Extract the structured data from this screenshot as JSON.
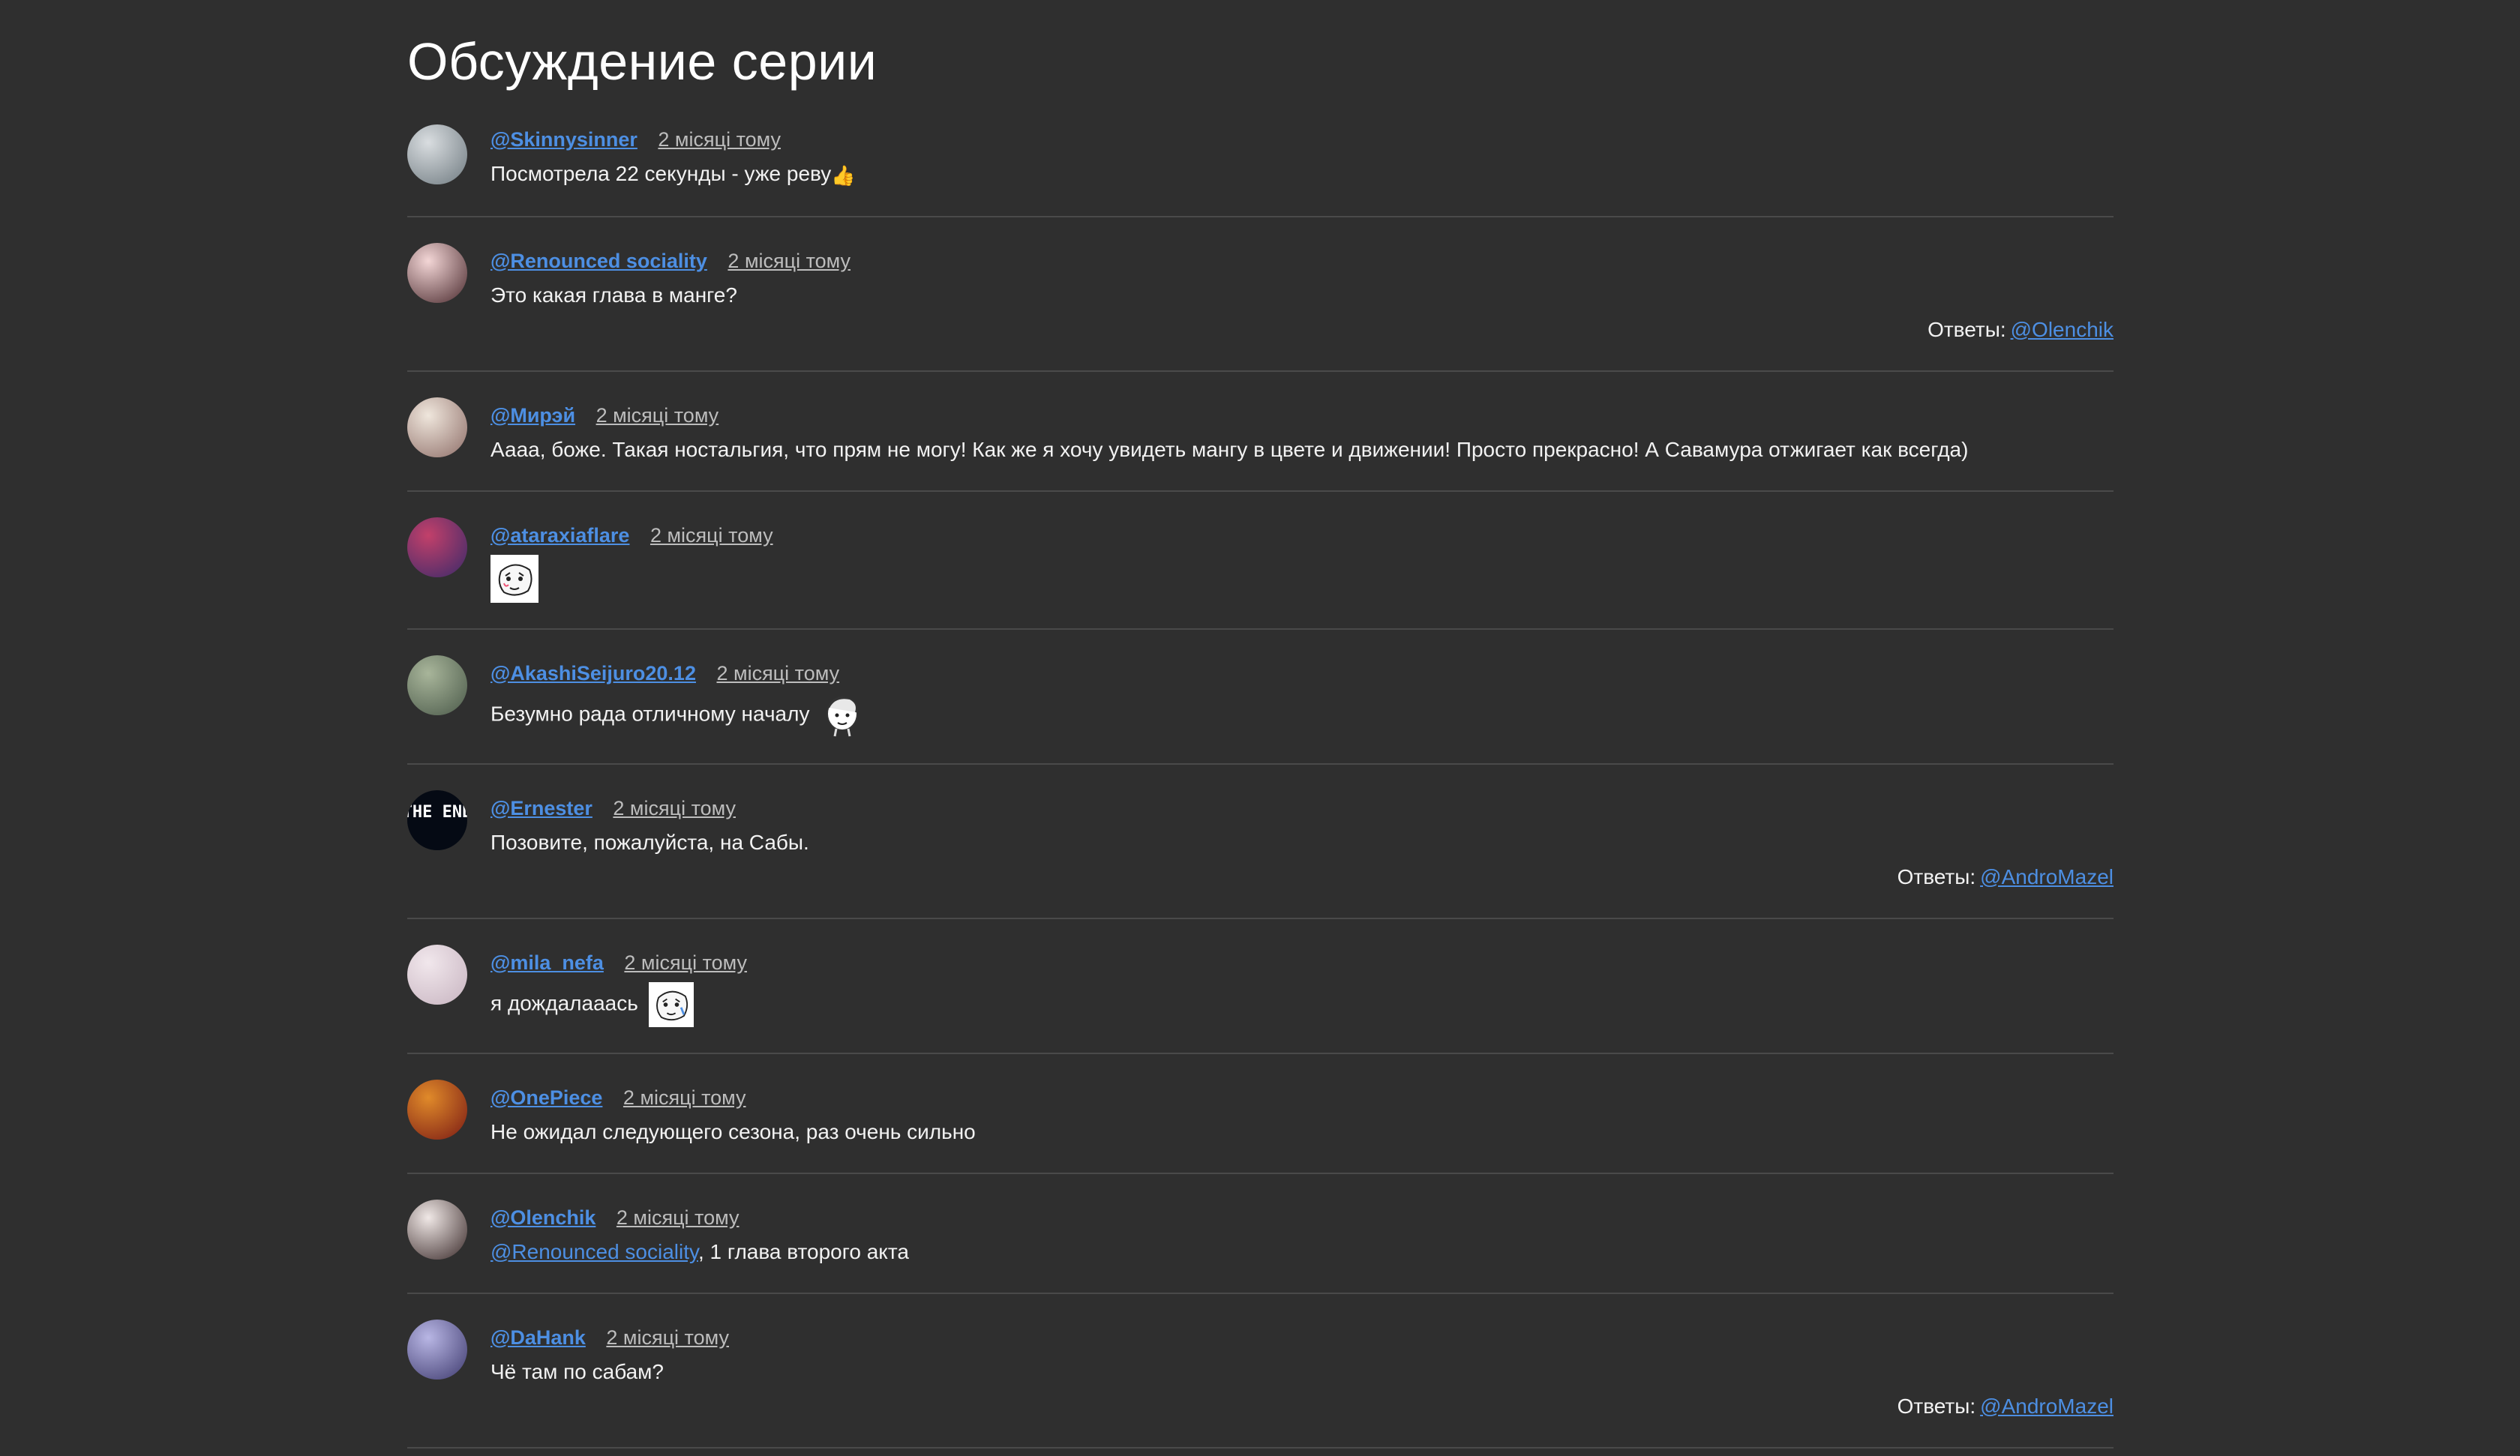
{
  "page": {
    "title": "Обсуждение серии",
    "replies_label": "Ответы:"
  },
  "comments": [
    {
      "author": "@Skinnysinner",
      "time": "2 місяці тому",
      "text": "Посмотрела 22 секунды - уже реву",
      "emoji": "👍",
      "avatar": {
        "c1": "#d9dde0",
        "c2": "#6f7a80"
      }
    },
    {
      "author": "@Renounced sociality",
      "time": "2 місяці тому",
      "text": "Это какая глава в манге?",
      "reply": "@Olenchik",
      "avatar": {
        "c1": "#f3d6d6",
        "c2": "#4a2a2e"
      }
    },
    {
      "author": "@Мирэй",
      "time": "2 місяці тому",
      "text": "Аааа, боже. Такая ностальгия, что прям не могу! Как же я хочу увидеть мангу в цвете и движении! Просто прекрасно! А Савамура отжигает как всегда)",
      "avatar": {
        "c1": "#efe6dc",
        "c2": "#8e6e68"
      }
    },
    {
      "author": "@ataraxiaflare",
      "time": "2 місяці тому",
      "text": "",
      "sticker": "sticker-face",
      "avatar": {
        "c1": "#c2406a",
        "c2": "#3a2a6a"
      }
    },
    {
      "author": "@AkashiSeijuro20.12",
      "time": "2 місяці тому",
      "text": "Безумно рада отличному началу",
      "sticker_inline": "sticker-sketch",
      "avatar": {
        "c1": "#a8b59a",
        "c2": "#4b5a4a"
      }
    },
    {
      "author": "@Ernester",
      "time": "2 місяці тому",
      "text": "Позовите, пожалуйста, на Сабы.",
      "reply": "@AndroMazel",
      "avatar_text": "THE END",
      "avatar": {
        "c1": "#0a0f1a",
        "c2": "#020408"
      }
    },
    {
      "author": "@mila_nefa",
      "time": "2 місяці тому",
      "text": "я дождалааась",
      "sticker_inline": "sticker-face",
      "avatar": {
        "c1": "#f1e7ec",
        "c2": "#c7b4c0"
      }
    },
    {
      "author": "@OnePiece",
      "time": "2 місяці тому",
      "text": "Не ожидал следующего сезона, раз очень сильно",
      "avatar": {
        "c1": "#e08a2a",
        "c2": "#7a1a14"
      }
    },
    {
      "author": "@Olenchik",
      "time": "2 місяці тому",
      "mention": "@Renounced sociality",
      "text": ", 1 глава второго акта",
      "avatar": {
        "c1": "#f0e8e6",
        "c2": "#3a2a2a"
      }
    },
    {
      "author": "@DaHank",
      "time": "2 місяці тому",
      "text": "Чё там по сабам?",
      "reply": "@AndroMazel",
      "avatar": {
        "c1": "#b8b6e4",
        "c2": "#3e3a6e"
      }
    }
  ],
  "colors": {
    "background": "#2f2f2f",
    "link": "#4d8fe3",
    "separator": "#4a4a4a",
    "time": "#bdbdbd"
  }
}
